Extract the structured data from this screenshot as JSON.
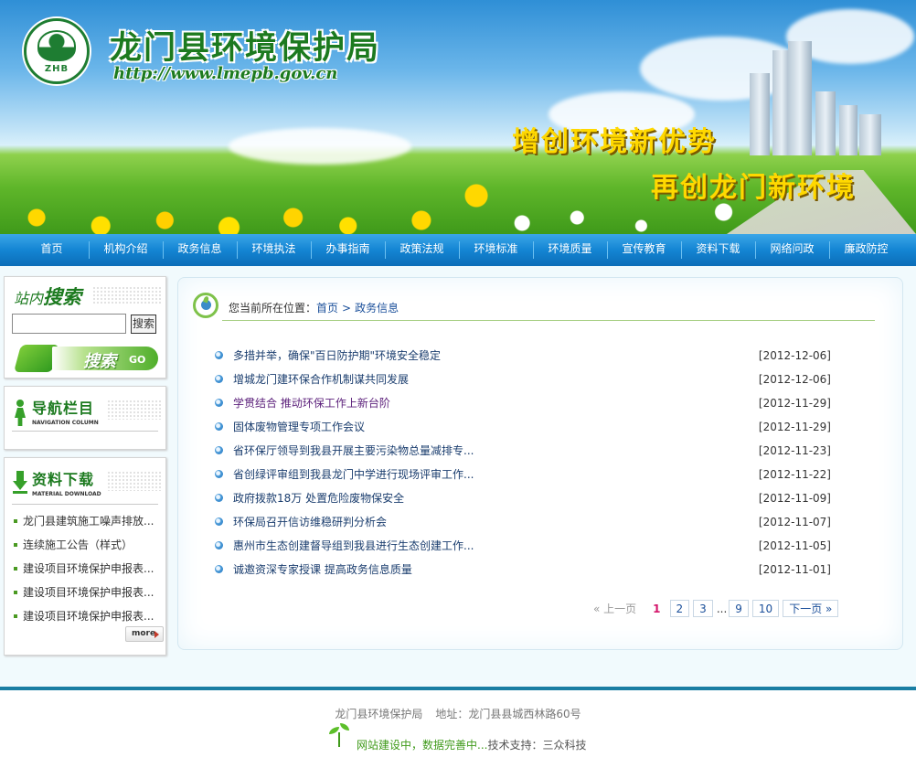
{
  "header": {
    "logo_text": "ZHB",
    "site_title": "龙门县环境保护局",
    "site_url": "http://www.lmepb.gov.cn",
    "slogan_1": "增创环境新优势",
    "slogan_2": "再创龙门新环境"
  },
  "nav": {
    "items": [
      "首页",
      "机构介绍",
      "政务信息",
      "环境执法",
      "办事指南",
      "政策法规",
      "环境标准",
      "环境质量",
      "宣传教育",
      "资料下载",
      "网络问政",
      "廉政防控"
    ]
  },
  "search": {
    "title_small": "站内",
    "title_big": "搜索",
    "input_value": "",
    "button_label": "搜索",
    "go_label": "搜索",
    "go_suffix": "GO"
  },
  "nav_column": {
    "title_cn": "导航栏目",
    "title_en": "NAVIGATION COLUMN"
  },
  "downloads": {
    "title_cn": "资料下载",
    "title_en": "MATERIAL DOWNLOAD",
    "items": [
      "龙门县建筑施工噪声排放...",
      "连续施工公告（样式）",
      "建设项目环境保护申报表...",
      "建设项目环境保护申报表...",
      "建设项目环境保护申报表..."
    ],
    "more_label": "more"
  },
  "breadcrumb": {
    "prefix": "您当前所在位置：",
    "home": "首页",
    "separator": ">",
    "current": "政务信息"
  },
  "news": [
    {
      "title": "多措并举，确保\"百日防护期\"环境安全稳定",
      "date": "[2012-12-06]"
    },
    {
      "title": "增城龙门建环保合作机制谋共同发展",
      "date": "[2012-12-06]"
    },
    {
      "title": "学贯结合 推动环保工作上新台阶",
      "date": "[2012-11-29]"
    },
    {
      "title": "固体废物管理专项工作会议",
      "date": "[2012-11-29]"
    },
    {
      "title": "省环保厅领导到我县开展主要污染物总量减排专...",
      "date": "[2012-11-23]"
    },
    {
      "title": "省创绿评审组到我县龙门中学进行现场评审工作...",
      "date": "[2012-11-22]"
    },
    {
      "title": "政府拨款18万 处置危险废物保安全",
      "date": "[2012-11-09]"
    },
    {
      "title": "环保局召开信访维稳研判分析会",
      "date": "[2012-11-07]"
    },
    {
      "title": "惠州市生态创建督导组到我县进行生态创建工作...",
      "date": "[2012-11-05]"
    },
    {
      "title": "诚邀资深专家授课 提高政务信息质量",
      "date": "[2012-11-01]"
    }
  ],
  "pager": {
    "prev": "« 上一页",
    "current": "1",
    "pages": [
      "2",
      "3"
    ],
    "ellipsis": "...",
    "tail_pages": [
      "9",
      "10"
    ],
    "next": "下一页 »"
  },
  "footer": {
    "org": "龙门县环境保护局",
    "address": "地址：龙门县县城西林路60号",
    "notice": "网站建设中，数据完善中...",
    "support": "技术支持：三众科技"
  },
  "colors": {
    "nav_blue": "#1485d3",
    "title_green": "#1c7a1f",
    "footer_bar": "#1a7ea3",
    "current_page": "#d4166b"
  }
}
